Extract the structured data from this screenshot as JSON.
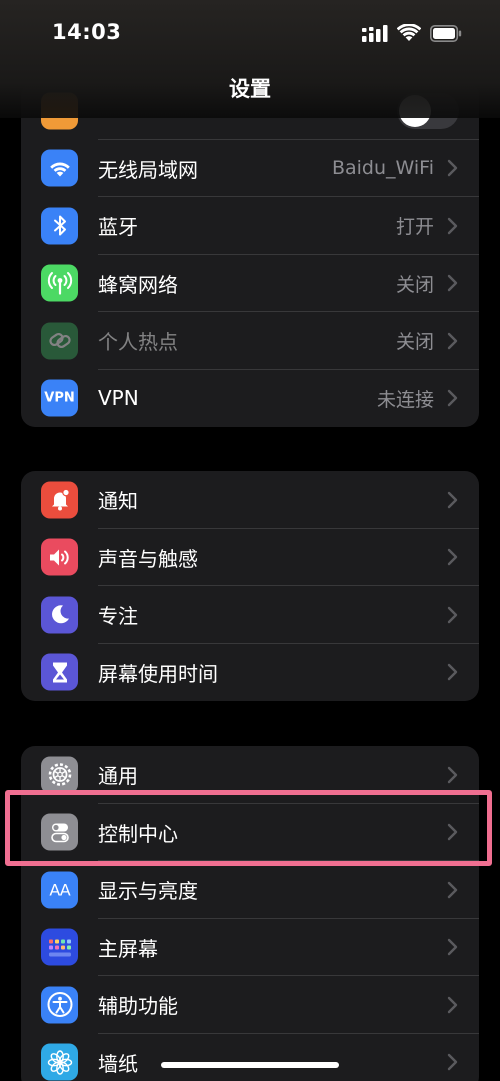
{
  "status": {
    "time": "14:03"
  },
  "nav": {
    "title": "设置"
  },
  "group1": {
    "items": [
      {
        "label": "",
        "value": ""
      },
      {
        "label": "无线局域网",
        "value": "Baidu_WiFi"
      },
      {
        "label": "蓝牙",
        "value": "打开"
      },
      {
        "label": "蜂窝网络",
        "value": "关闭"
      },
      {
        "label": "个人热点",
        "value": "关闭"
      },
      {
        "label": "VPN",
        "value": "未连接",
        "icon_text": "VPN"
      }
    ]
  },
  "group2": {
    "items": [
      {
        "label": "通知"
      },
      {
        "label": "声音与触感"
      },
      {
        "label": "专注"
      },
      {
        "label": "屏幕使用时间"
      }
    ]
  },
  "group3": {
    "items": [
      {
        "label": "通用"
      },
      {
        "label": "控制中心"
      },
      {
        "label": "显示与亮度",
        "icon_text": "AA"
      },
      {
        "label": "主屏幕"
      },
      {
        "label": "辅助功能"
      },
      {
        "label": "墙纸"
      }
    ]
  },
  "colors": {
    "orange": "#f09a37",
    "blue": "#3a82f7",
    "green": "#4cd964",
    "hotspot_green": "#3aa35a",
    "red": "#eb4d3d",
    "pink_red": "#ea4b5f",
    "indigo": "#5b56d6",
    "gray": "#8e8e93",
    "highlight": "#f06f91"
  }
}
